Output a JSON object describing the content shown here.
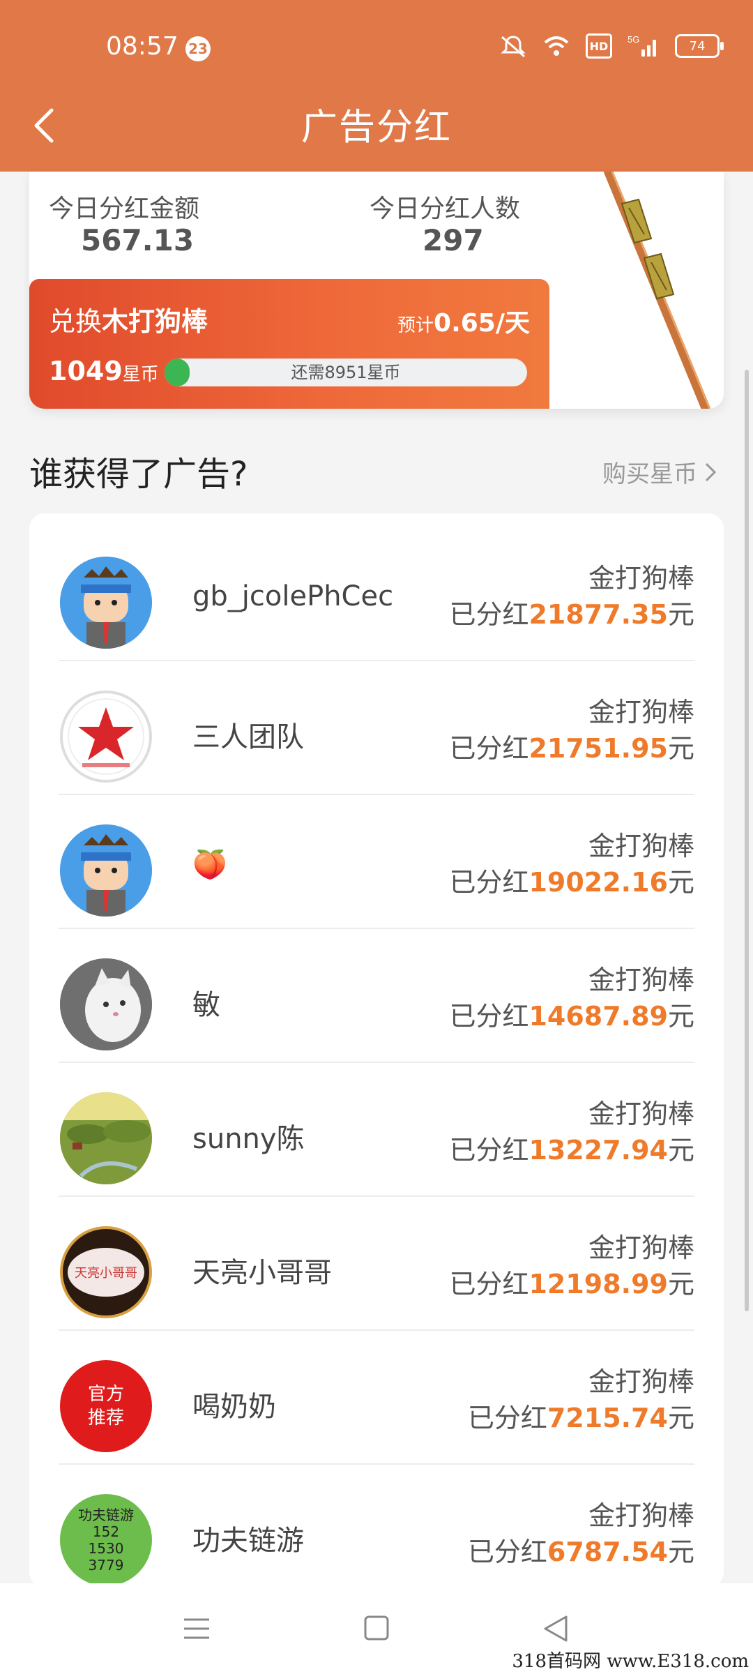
{
  "status": {
    "time": "08:57",
    "badge": "23",
    "hd": "HD",
    "signal": "5G",
    "battery": "74"
  },
  "header": {
    "title": "广告分红"
  },
  "summary": {
    "today_amount_label": "今日分红金额",
    "today_amount_value": "567.13",
    "today_people_label": "今日分红人数",
    "today_people_value": "297"
  },
  "exchange": {
    "prefix": "兑换",
    "item": "木打狗棒",
    "estimate_label": "预计",
    "estimate_value": "0.65/天",
    "coins_value": "1049",
    "coins_unit": "星币",
    "progress_text": "还需8951星币",
    "progress_fraction": 0.07
  },
  "section": {
    "title": "谁获得了广告?",
    "buy_link": "购买星币"
  },
  "list": [
    {
      "name": "gb_jcolePhCec",
      "prize": "金打狗棒",
      "prefix": "已分红",
      "amount": "21877.35",
      "suffix": "元",
      "avatar": "cartoon-avatar"
    },
    {
      "name": "三人团队",
      "prize": "金打狗棒",
      "prefix": "已分红",
      "amount": "21751.95",
      "suffix": "元",
      "avatar": "red-star-avatar"
    },
    {
      "name": "🍑",
      "prize": "金打狗棒",
      "prefix": "已分红",
      "amount": "19022.16",
      "suffix": "元",
      "avatar": "cartoon-avatar"
    },
    {
      "name": "敏",
      "prize": "金打狗棒",
      "prefix": "已分红",
      "amount": "14687.89",
      "suffix": "元",
      "avatar": "cat-avatar"
    },
    {
      "name": "sunny陈",
      "prize": "金打狗棒",
      "prefix": "已分红",
      "amount": "13227.94",
      "suffix": "元",
      "avatar": "landscape-avatar"
    },
    {
      "name": "天亮小哥哥",
      "prize": "金打狗棒",
      "prefix": "已分红",
      "amount": "12198.99",
      "suffix": "元",
      "avatar": "text-avatar",
      "avatar_text": "天亮小哥哥"
    },
    {
      "name": "喝奶奶",
      "prize": "金打狗棒",
      "prefix": "已分红",
      "amount": "7215.74",
      "suffix": "元",
      "avatar": "official-avatar",
      "avatar_text_1": "官方",
      "avatar_text_2": "推荐"
    },
    {
      "name": "功夫链游",
      "prize": "金打狗棒",
      "prefix": "已分红",
      "amount": "6787.54",
      "suffix": "元",
      "avatar": "green-text-avatar",
      "avatar_lines": [
        "功夫链游",
        "152",
        "1530",
        "3779"
      ]
    }
  ],
  "watermark": "318首码网 www.E318.com"
}
